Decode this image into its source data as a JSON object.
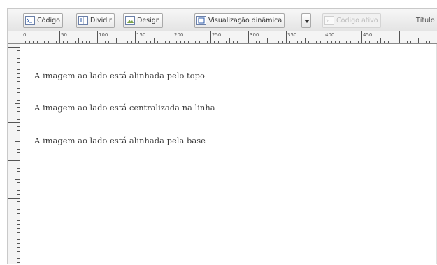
{
  "toolbar": {
    "code_label": "Código",
    "split_label": "Dividir",
    "design_label": "Design",
    "live_view_label": "Visualização dinâmica",
    "live_code_label": "Código ativo",
    "title_label": "Título"
  },
  "ruler": {
    "marks": [
      "0",
      "50",
      "100",
      "150",
      "200",
      "250",
      "300",
      "350",
      "400",
      "450"
    ]
  },
  "document": {
    "lines": [
      "A imagem ao lado está alinhada pelo topo",
      "A imagem ao lado está centralizada na linha",
      "A imagem ao lado está alinhada pela base"
    ]
  }
}
